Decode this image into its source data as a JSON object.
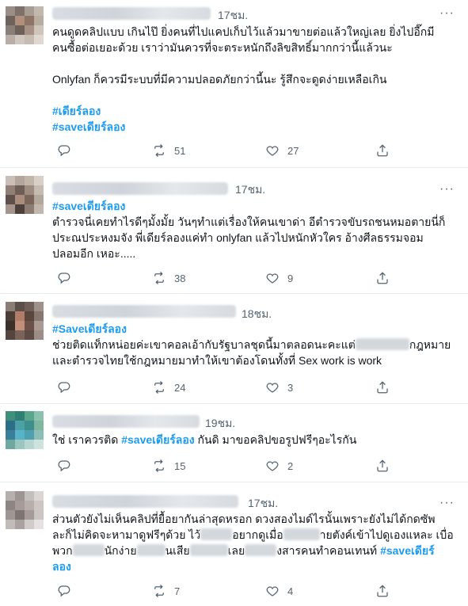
{
  "tweets": [
    {
      "time": "17ชม.",
      "more": "···",
      "lines": [
        [
          {
            "t": "คนดูดคลิปแบบ เกินไป๊ ยิ่งคนที่ไปแคปเก็บไว้แล้วมาขายต่อแล้วใหญ่เลย ยิ่งไปอี๊กมี"
          }
        ],
        [
          {
            "t": "คนซื้อต่อเยอะด้วย เราว่ามันควรที่จะตระหนักถึงลิขสิทธิ์มากกว่านี้แล้วนะ"
          }
        ],
        [],
        [
          {
            "t": "Onlyfan ก็ควรมีระบบที่มีความปลอดภัยกว่านี้นะ รู้สึกจะดูดง่ายเหลือเกิน"
          }
        ],
        [],
        [
          {
            "t": "#เดียร์ลอง",
            "h": true
          }
        ],
        [
          {
            "t": "#saveเดียร์ลอง",
            "h": true
          }
        ]
      ],
      "replies": "",
      "retweets": "51",
      "likes": "27"
    },
    {
      "time": "17ชม.",
      "more": "···",
      "lines": [
        [
          {
            "t": "#saveเดียร์ลอง",
            "h": true
          }
        ],
        [
          {
            "t": "ตำรวจนี่เคยทำไรดีๆมั้งมั้ย วันๆทำแต่เรื่องให้คนเขาด่า อีตำรวจขับรถชนหมอตายนี่ก็"
          }
        ],
        [
          {
            "t": "ประณประหงมจัง พี่เดียร์ลองแค่ทำ onlyfan แล้วไปหนักหัวใคร อ้างศีลธรรมจอม"
          }
        ],
        [
          {
            "t": "ปลอมอีก เหอะ....."
          }
        ]
      ],
      "replies": "",
      "retweets": "38",
      "likes": "9"
    },
    {
      "time": "18ชม.",
      "more": "",
      "lines": [
        [
          {
            "t": "#Saveเดียร์ลอง",
            "h": true
          }
        ],
        [
          {
            "t": "ช่วยติดแท็กหน่อยค่ะเขาคอลเอ้ากับรัฐบาลชุดนี้มาตลอดนะคะแต่"
          },
          {
            "r": 68
          },
          {
            "t": "กฎหมาย"
          }
        ],
        [
          {
            "t": "และตำรวจไทยใช้กฎหมายมาทำให้เขาต้องโดนทั้งที่ Sex work is work"
          }
        ]
      ],
      "replies": "",
      "retweets": "24",
      "likes": "3"
    },
    {
      "time": "19ชม.",
      "more": "",
      "lines": [
        [
          {
            "t": "ใช่ เราควรติด "
          },
          {
            "t": "#saveเดียร์ลอง",
            "h": true
          },
          {
            "t": " กันดิ มาขอคลิปขอรูปฟรีๆอะไรกัน"
          }
        ]
      ],
      "replies": "",
      "retweets": "15",
      "likes": "2"
    },
    {
      "time": "17ชม.",
      "more": "···",
      "lines": [
        [
          {
            "t": "ส่วนตัวยังไม่เห็นคลิปที่ยื้อยากันล่าสุดหรอก ดวงสองไมด์ไรนั้นเพราะยังไม่ได้กดซัพ"
          }
        ],
        [
          {
            "t": "ละก็ไม่คิดจะหามาดูฟรีๆด้วย ไว้"
          },
          {
            "r": 40
          },
          {
            "t": "อยากดูเมื่อ"
          },
          {
            "r": 46
          },
          {
            "t": "ายตังค์เข้าไปดูเองแหละ เบื่อ"
          }
        ],
        [
          {
            "t": "พวก"
          },
          {
            "r": 40
          },
          {
            "t": "นักง่าย"
          },
          {
            "r": 36
          },
          {
            "t": "นเสีย"
          },
          {
            "r": 48
          },
          {
            "t": "เลย"
          },
          {
            "r": 40
          },
          {
            "t": "งสารคนทำคอนเทนท์ "
          },
          {
            "t": "#saveเดียร์",
            "h": true
          }
        ],
        [
          {
            "t": "ลอง",
            "h": true
          }
        ]
      ],
      "replies": "",
      "retweets": "7",
      "likes": "4"
    }
  ]
}
